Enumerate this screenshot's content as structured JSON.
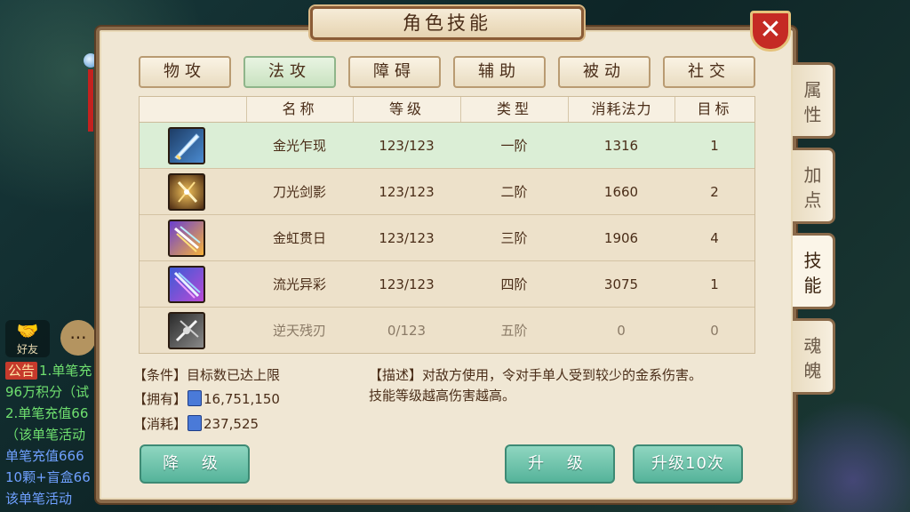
{
  "window": {
    "title": "角色技能",
    "close_glyph": "✕"
  },
  "skill_tabs": [
    {
      "label": "物攻",
      "active": false
    },
    {
      "label": "法攻",
      "active": true
    },
    {
      "label": "障碍",
      "active": false
    },
    {
      "label": "辅助",
      "active": false
    },
    {
      "label": "被动",
      "active": false
    },
    {
      "label": "社交",
      "active": false
    }
  ],
  "table": {
    "headers": [
      "",
      "名称",
      "等级",
      "类型",
      "消耗法力",
      "目标"
    ],
    "rows": [
      {
        "icon": "golden-blade-icon",
        "name": "金光乍现",
        "level": "123/123",
        "type": "一阶",
        "mana": "1316",
        "target": "1",
        "selected": true,
        "disabled": false
      },
      {
        "icon": "sword-light-icon",
        "name": "刀光剑影",
        "level": "123/123",
        "type": "二阶",
        "mana": "1660",
        "target": "2",
        "selected": false,
        "disabled": false
      },
      {
        "icon": "rainbow-sword-icon",
        "name": "金虹贯日",
        "level": "123/123",
        "type": "三阶",
        "mana": "1906",
        "target": "4",
        "selected": false,
        "disabled": false
      },
      {
        "icon": "flowing-light-icon",
        "name": "流光异彩",
        "level": "123/123",
        "type": "四阶",
        "mana": "3075",
        "target": "1",
        "selected": false,
        "disabled": false
      },
      {
        "icon": "heaven-blade-icon",
        "name": "逆天残刃",
        "level": "0/123",
        "type": "五阶",
        "mana": "0",
        "target": "0",
        "selected": false,
        "disabled": true
      }
    ]
  },
  "info": {
    "condition": "【条件】目标数已达上限",
    "owned_label": "【拥有】",
    "owned_value": "16,751,150",
    "cost_label": "【消耗】",
    "cost_value": "237,525",
    "description_line1": "【描述】对敌方使用，令对手单人受到较少的金系伤害。",
    "description_line2": "技能等级越高伤害越高。"
  },
  "buttons": {
    "downgrade": "降 级",
    "upgrade": "升 级",
    "upgrade10": "升级10次"
  },
  "side_tabs": [
    {
      "label": "属性",
      "active": false
    },
    {
      "label": "加点",
      "active": false
    },
    {
      "label": "技能",
      "active": true
    },
    {
      "label": "魂魄",
      "active": false
    }
  ],
  "chat": {
    "friend_label": "好友",
    "badge": "公告",
    "lines": [
      "1.单笔充",
      "96万积分（试",
      "2.单笔充值66",
      "（该单笔活动",
      "单笔充值666",
      "10颗+盲盒66",
      "该单笔活动"
    ]
  },
  "colors": {
    "panel_bg": "#f0e7d4",
    "selected_row": "#dbeed6",
    "active_tab": "#c9e2c0",
    "button": "#55b39a",
    "close": "#c52a24"
  }
}
